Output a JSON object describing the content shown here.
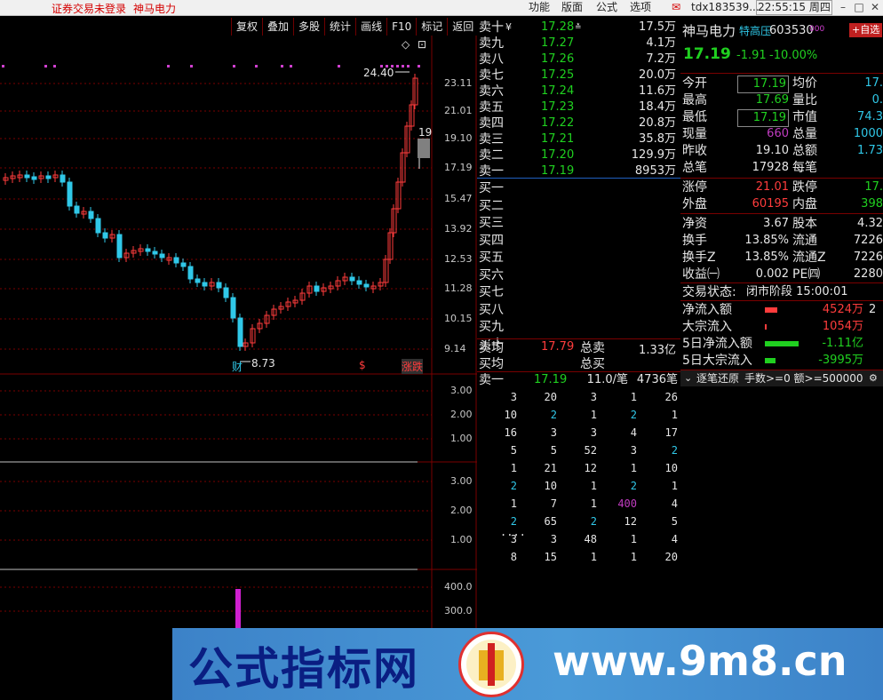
{
  "topbar": {
    "status_text": "证券交易未登录",
    "stock_name": "神马电力",
    "menu": [
      "功能",
      "版面",
      "公式",
      "选项"
    ],
    "account": "tdx183539...",
    "clock": "22:55:15 周四"
  },
  "toolbar": [
    "复权",
    "叠加",
    "多股",
    "统计",
    "画线",
    "F10",
    "标记",
    "返回"
  ],
  "chart": {
    "price_axis": [
      "23.11",
      "21.01",
      "19.10",
      "17.19",
      "15.47",
      "13.92",
      "12.53",
      "11.28",
      "10.15",
      "9.14"
    ],
    "high_label": "24.40",
    "low_label": "8.73",
    "current_marker": "19",
    "event_badges": [
      "财",
      "$",
      "涨跌"
    ],
    "ind1_axis": [
      "3.00",
      "2.00",
      "1.00"
    ],
    "ind2_axis": [
      "3.00",
      "2.00",
      "1.00"
    ],
    "ind3_axis": [
      "400.0",
      "300.0"
    ]
  },
  "orderbook": {
    "asks": [
      {
        "label": "卖十",
        "mark": "¥",
        "price": "17.28",
        "flag": "≛",
        "vol": "17.5万"
      },
      {
        "label": "卖九",
        "mark": "",
        "price": "17.27",
        "flag": "",
        "vol": "4.1万"
      },
      {
        "label": "卖八",
        "mark": "",
        "price": "17.26",
        "flag": "",
        "vol": "7.2万"
      },
      {
        "label": "卖七",
        "mark": "",
        "price": "17.25",
        "flag": "",
        "vol": "20.0万"
      },
      {
        "label": "卖六",
        "mark": "",
        "price": "17.24",
        "flag": "",
        "vol": "11.6万"
      },
      {
        "label": "卖五",
        "mark": "",
        "price": "17.23",
        "flag": "",
        "vol": "18.4万"
      },
      {
        "label": "卖四",
        "mark": "",
        "price": "17.22",
        "flag": "",
        "vol": "20.8万"
      },
      {
        "label": "卖三",
        "mark": "",
        "price": "17.21",
        "flag": "",
        "vol": "35.8万"
      },
      {
        "label": "卖二",
        "mark": "",
        "price": "17.20",
        "flag": "",
        "vol": "129.9万"
      },
      {
        "label": "卖一",
        "mark": "",
        "price": "17.19",
        "flag": "",
        "vol": "8953万"
      }
    ],
    "bids": [
      "买一",
      "买二",
      "买三",
      "买四",
      "买五",
      "买六",
      "买七",
      "买八",
      "买九",
      "买十"
    ],
    "avg_sell_label": "卖均",
    "avg_sell_price": "17.79",
    "total_sell_label": "总卖",
    "total_sell_value": "1.33亿",
    "avg_buy_label": "买均",
    "total_buy_label": "总买"
  },
  "ticks": {
    "head_label": "卖一",
    "head_price": "17.19",
    "head_per": "11.0/笔",
    "head_count": "4736笔",
    "rows": [
      [
        "3",
        "20",
        "3",
        "1",
        "26"
      ],
      [
        "10",
        "2",
        "1",
        "2",
        "1"
      ],
      [
        "16",
        "3",
        "3",
        "4",
        "17"
      ],
      [
        "5",
        "5",
        "52",
        "3",
        "2"
      ],
      [
        "1",
        "21",
        "12",
        "1",
        "10"
      ],
      [
        "2",
        "10",
        "1",
        "2",
        "1"
      ],
      [
        "1",
        "7",
        "1",
        "400",
        "4"
      ],
      [
        "2",
        "65",
        "2",
        "12",
        "5"
      ],
      [
        "3",
        "3",
        "48",
        "1",
        "4"
      ],
      [
        "8",
        "15",
        "1",
        "1",
        "20"
      ]
    ],
    "more": "....",
    "colors": [
      [
        "w",
        "w",
        "w",
        "w",
        "w"
      ],
      [
        "w",
        "c",
        "w",
        "c",
        "w"
      ],
      [
        "w",
        "w",
        "w",
        "w",
        "w"
      ],
      [
        "w",
        "w",
        "w",
        "w",
        "c"
      ],
      [
        "w",
        "w",
        "w",
        "w",
        "w"
      ],
      [
        "c",
        "w",
        "w",
        "c",
        "w"
      ],
      [
        "w",
        "w",
        "w",
        "p",
        "w"
      ],
      [
        "c",
        "w",
        "c",
        "w",
        "w"
      ],
      [
        "w",
        "w",
        "w",
        "w",
        "w"
      ],
      [
        "w",
        "w",
        "w",
        "w",
        "w"
      ]
    ]
  },
  "quote": {
    "name": "神马电力",
    "tag": "特高压",
    "code": "603530",
    "code_suffix": "000",
    "add_fav": "+自选",
    "price": "17.19",
    "change": "-1.91",
    "pct": "-10.00%",
    "fields": [
      {
        "l1": "今开",
        "v1": "17.19",
        "c1": "green",
        "b1": true,
        "l2": "均价",
        "v2": "17."
      },
      {
        "l1": "最高",
        "v1": "17.69",
        "c1": "green",
        "b1": false,
        "l2": "量比",
        "v2": "0."
      },
      {
        "l1": "最低",
        "v1": "17.19",
        "c1": "green",
        "b1": true,
        "l2": "市值",
        "v2": "74.3"
      },
      {
        "l1": "现量",
        "v1": "660",
        "c1": "purple",
        "b1": false,
        "l2": "总量",
        "v2": "1000"
      },
      {
        "l1": "昨收",
        "v1": "19.10",
        "c1": "white",
        "b1": false,
        "l2": "总额",
        "v2": "1.73"
      },
      {
        "l1": "总笔",
        "v1": "17928",
        "c1": "white",
        "b1": false,
        "l2": "每笔",
        "v2": ""
      }
    ],
    "limits": [
      {
        "l1": "涨停",
        "v1": "21.01",
        "c1": "red",
        "l2": "跌停",
        "v2": "17."
      },
      {
        "l1": "外盘",
        "v1": "60195",
        "c1": "red",
        "l2": "内盘",
        "v2": "398"
      }
    ],
    "fundamentals": [
      {
        "l1": "净资",
        "v1": "3.67",
        "l2": "股本",
        "v2": "4.32"
      },
      {
        "l1": "换手",
        "v1": "13.85%",
        "l2": "流通",
        "v2": "7226"
      },
      {
        "l1": "换手Z",
        "v1": "13.85%",
        "l2": "流通Z",
        "v2": "7226"
      },
      {
        "l1": "收益㈠",
        "v1": "0.002",
        "l2": "PE㈣",
        "v2": "2280"
      }
    ],
    "trade_status_label": "交易状态:",
    "trade_status": "闭市阶段 15:00:01",
    "flows": [
      {
        "label": "净流入额",
        "value": "4524万",
        "extra": "2",
        "vclass": "red",
        "bar": "red",
        "bar_w": 14
      },
      {
        "label": "大宗流入",
        "value": "1054万",
        "extra": "",
        "vclass": "red",
        "bar": "red",
        "bar_w": 2
      },
      {
        "label": "5日净流入额",
        "value": "-1.11亿",
        "extra": "",
        "vclass": "green",
        "bar": "green",
        "bar_w": 38
      },
      {
        "label": "5日大宗流入",
        "value": "-3995万",
        "extra": "",
        "vclass": "green",
        "bar": "green",
        "bar_w": 12
      }
    ],
    "filter_title": "逐笔还原",
    "filter_text": "手数>=0 额>=500000"
  },
  "watermark": {
    "cn": "公式指标网",
    "url": "www.9m8.cn"
  }
}
